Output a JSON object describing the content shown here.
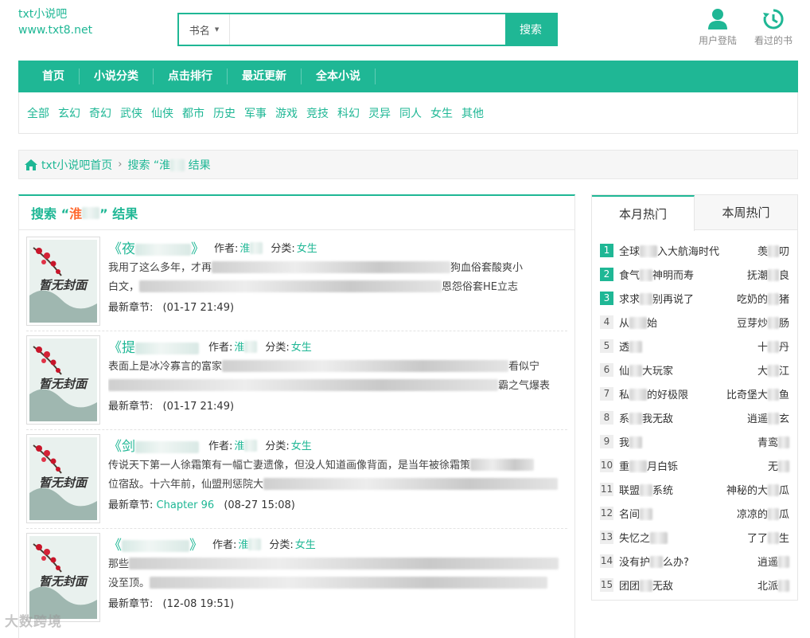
{
  "logo": {
    "line1": "txt小说吧",
    "line2": "www.txt8.net"
  },
  "search": {
    "select_label": "书名",
    "button_label": "搜索",
    "placeholder": ""
  },
  "header_links": {
    "login": "用户登陆",
    "history": "看过的书"
  },
  "nav": [
    "首页",
    "小说分类",
    "点击排行",
    "最近更新",
    "全本小说"
  ],
  "categories": [
    "全部",
    "玄幻",
    "奇幻",
    "武侠",
    "仙侠",
    "都市",
    "历史",
    "军事",
    "游戏",
    "竞技",
    "科幻",
    "灵异",
    "同人",
    "女生",
    "其他"
  ],
  "breadcrumb": {
    "home": "txt小说吧首页",
    "current_prefix": "搜索 “淮",
    "current_suffix": " 结果"
  },
  "results": {
    "heading_prefix": "搜索 “",
    "keyword": "淮",
    "heading_suffix": "” 结果",
    "author_label": "作者:",
    "category_label": "分类:",
    "latest_label": "最新章节:",
    "cover_text": "暂无封面",
    "books": [
      {
        "title": "《夜",
        "title_end": "》",
        "author": "淮",
        "category": "女生",
        "desc1": "我用了这么多年，才再",
        "desc1_end": "狗血俗套酸爽小",
        "desc2": "白文，",
        "desc2_end": "恩怨俗套HE立志",
        "latest_chapter": "",
        "time": "(01-17 21:49)"
      },
      {
        "title": "《提",
        "title_end": "",
        "author": "淮",
        "category": "女生",
        "desc1": "表面上是冰冷寡言的富家",
        "desc1_end": "看似宁",
        "desc2": "",
        "desc2_end": "霸之气爆表",
        "latest_chapter": "",
        "time": "(01-17 21:49)"
      },
      {
        "title": "《剑",
        "title_end": "",
        "author": "淮",
        "category": "女生",
        "desc1": "传说天下第一人徐霜策有一幅亡妻遗像，但没人知道画像背面，是当年被徐霜策",
        "desc1_end": "",
        "desc2": "位宿敌。十六年前，仙盟刑惩院大",
        "desc2_end": "",
        "latest_chapter": "Chapter 96",
        "time": "(08-27 15:08)"
      },
      {
        "title": "《",
        "title_end": "》",
        "author": "淮",
        "category": "女生",
        "desc1": "那些",
        "desc1_end": "",
        "desc2": "没至顶。",
        "desc2_end": "",
        "latest_chapter": "",
        "time": "(12-08 19:51)"
      }
    ]
  },
  "hot": {
    "tabs": [
      "本月热门",
      "本周热门"
    ],
    "items": [
      {
        "n": "1",
        "title": "全球",
        "title_end": "入大航海时代",
        "author": "羡",
        "author_end": "叨"
      },
      {
        "n": "2",
        "title": "食气",
        "title_end": "神明而寿",
        "author": "抚潮",
        "author_end": "良"
      },
      {
        "n": "3",
        "title": "求求",
        "title_end": "别再说了",
        "author": "吃奶的",
        "author_end": "猪"
      },
      {
        "n": "4",
        "title": "从",
        "title_end": "始",
        "author": "豆芽炒",
        "author_end": "肠"
      },
      {
        "n": "5",
        "title": "透",
        "title_end": "",
        "author": "十",
        "author_end": "丹"
      },
      {
        "n": "6",
        "title": "仙",
        "title_end": "大玩家",
        "author": "大",
        "author_end": "江"
      },
      {
        "n": "7",
        "title": "私",
        "title_end": "的好极限",
        "author": "比奇堡大",
        "author_end": "鱼"
      },
      {
        "n": "8",
        "title": "系",
        "title_end": "我无敌",
        "author": "逍遥",
        "author_end": "玄"
      },
      {
        "n": "9",
        "title": "我",
        "title_end": "",
        "author": "青鸾",
        "author_end": ""
      },
      {
        "n": "10",
        "title": "重",
        "title_end": "月白铄",
        "author": "无",
        "author_end": ""
      },
      {
        "n": "11",
        "title": "联盟",
        "title_end": "系统",
        "author": "神秘的大",
        "author_end": "瓜"
      },
      {
        "n": "12",
        "title": "名间",
        "title_end": "",
        "author": "凉凉的",
        "author_end": "瓜"
      },
      {
        "n": "13",
        "title": "失忆之",
        "title_end": "",
        "author": "了了",
        "author_end": "生"
      },
      {
        "n": "14",
        "title": "没有护",
        "title_end": "么办?",
        "author": "逍遥",
        "author_end": ""
      },
      {
        "n": "15",
        "title": "团团",
        "title_end": "无敌",
        "author": "北派",
        "author_end": ""
      }
    ]
  },
  "watermark": "大数跨境"
}
